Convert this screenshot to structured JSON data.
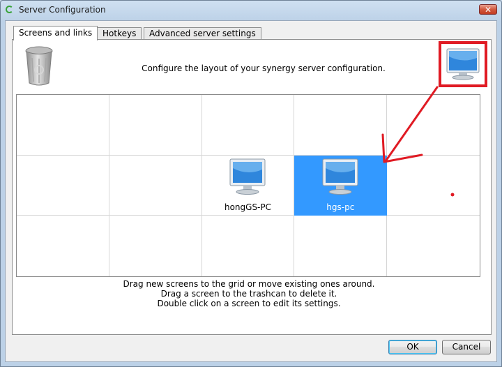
{
  "window": {
    "title": "Server Configuration",
    "close_glyph": "✕"
  },
  "tabs": [
    {
      "label": "Screens and links",
      "active": true
    },
    {
      "label": "Hotkeys",
      "active": false
    },
    {
      "label": "Advanced server settings",
      "active": false
    }
  ],
  "screens_panel": {
    "intro": "Configure the layout of your synergy server configuration.",
    "trash_icon": "trashcan-icon",
    "new_screen_icon": "monitor-icon",
    "grid": {
      "columns": 5,
      "rows": 3,
      "screens": [
        {
          "name": "hongGS-PC",
          "row": 2,
          "col": 3,
          "selected": false
        },
        {
          "name": "hgs-pc",
          "row": 2,
          "col": 4,
          "selected": true
        }
      ]
    },
    "instructions": [
      "Drag new screens to the grid or move existing ones around.",
      "Drag a screen to the trashcan to delete it.",
      "Double click on a screen to edit its settings."
    ]
  },
  "buttons": {
    "ok": "OK",
    "cancel": "Cancel"
  },
  "colors": {
    "selection": "#3399ff",
    "annotation": "#e01b24"
  }
}
